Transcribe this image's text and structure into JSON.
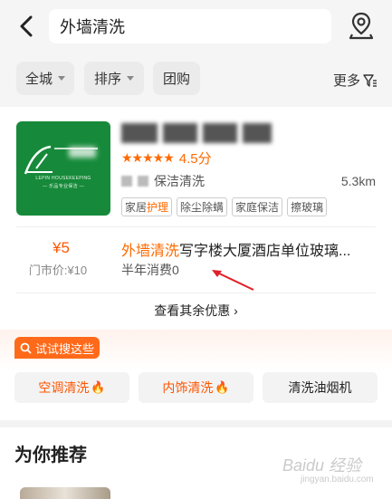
{
  "search": {
    "query": "外墙清洗"
  },
  "filters": {
    "city": "全城",
    "sort": "排序",
    "group": "团购",
    "more": "更多"
  },
  "shop": {
    "logo_brand": "LEPIN HOUSEKEEPING",
    "logo_sub": "— 乐品专业保洁 —",
    "rating_stars": "★★★★★",
    "rating": "4.5分",
    "type": "保洁清洗",
    "distance": "5.3km",
    "tags": [
      {
        "pre": "家居",
        "hl": "护理"
      },
      {
        "pre": "除尘除螨",
        "hl": ""
      },
      {
        "pre": "家庭保洁",
        "hl": ""
      },
      {
        "pre": "擦玻璃",
        "hl": ""
      }
    ]
  },
  "deal": {
    "price": "¥5",
    "original_price": "门市价:¥10",
    "title_keyword": "外墙清洗",
    "title_rest": "写字楼大厦酒店单位玻璃...",
    "sales": "半年消费0",
    "more_deals": "查看其余优惠 ›"
  },
  "try_search": {
    "label": "试试搜这些",
    "items": [
      {
        "label": "空调清洗",
        "icon": "fire-icon"
      },
      {
        "label": "内饰清洗",
        "icon": "fire-icon"
      },
      {
        "label": "清洗油烟机",
        "icon": ""
      }
    ]
  },
  "recommend": {
    "title": "为你推荐"
  },
  "watermark": {
    "brand": "Baidu 经验",
    "sub": "jingyan.baidu.com"
  },
  "colors": {
    "accent": "#ff6a00",
    "logo_bg": "#168a3a",
    "annotation": "#e0202a"
  }
}
